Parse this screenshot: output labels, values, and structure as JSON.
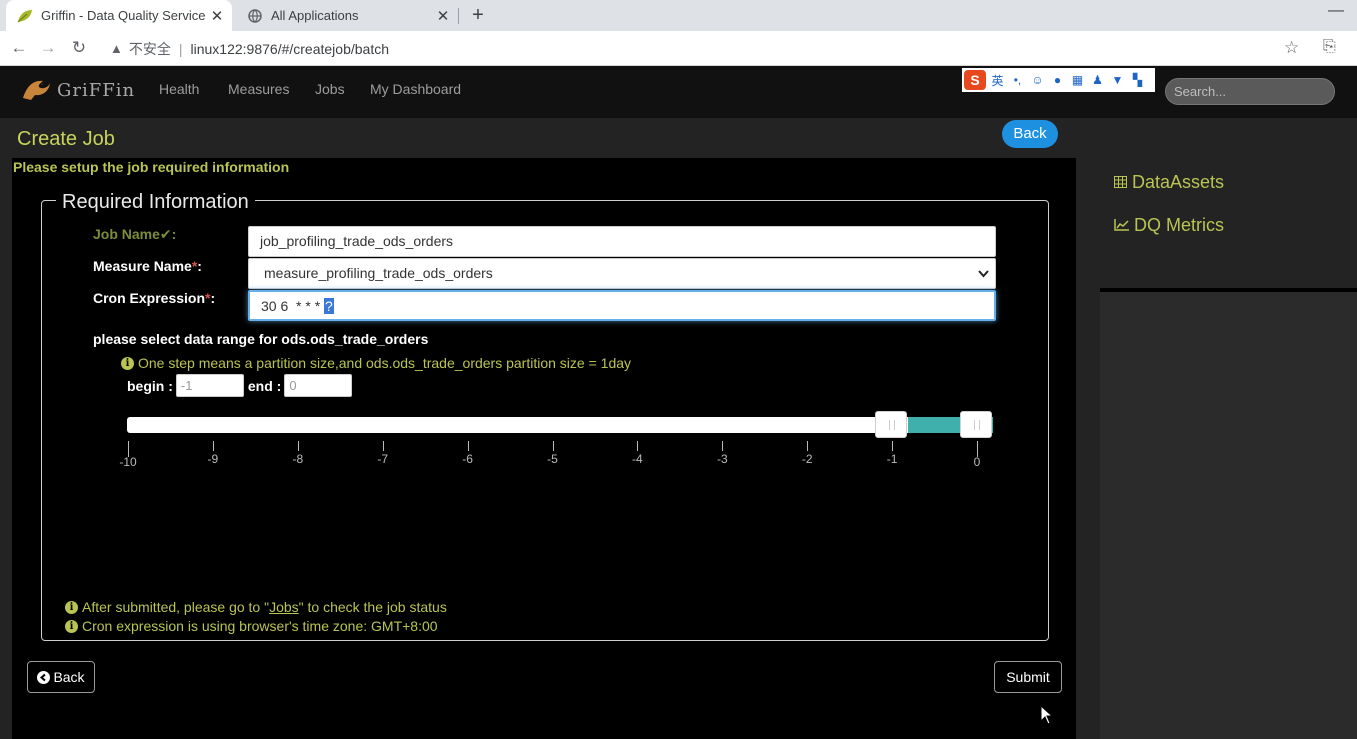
{
  "browser": {
    "tabs": [
      {
        "title": "Griffin - Data Quality Service",
        "active": true
      },
      {
        "title": "All Applications",
        "active": false
      }
    ],
    "address": {
      "insecure_label": "不安全",
      "url": "linux122:9876/#/createjob/batch"
    }
  },
  "navbar": {
    "brand": "GriFFin",
    "items": [
      "Health",
      "Measures",
      "Jobs",
      "My Dashboard"
    ],
    "ime": {
      "lang": "英"
    },
    "search_placeholder": "Search..."
  },
  "page": {
    "title": "Create Job",
    "back_top_label": "Back",
    "subtitle": "Please setup the job required information",
    "section_title": "Required Information"
  },
  "form": {
    "job_name_label": "Job Name",
    "job_name_value": "job_profiling_trade_ods_orders",
    "measure_name_label": "Measure Name",
    "measure_name_value": "measure_profiling_trade_ods_orders",
    "cron_label": "Cron Expression",
    "cron_value": "30 6  * * * ",
    "cron_selected": "?",
    "required_mark": "*",
    "colon": ":"
  },
  "range": {
    "title": "please select data range for ods.ods_trade_orders",
    "info": "One step means a partition size,and ods.ods_trade_orders partition size = 1day",
    "begin_label": "begin :",
    "begin_value": "-1",
    "end_label": "end :",
    "end_value": "0",
    "ticks": [
      "-10",
      "-9",
      "-8",
      "-7",
      "-6",
      "-5",
      "-4",
      "-3",
      "-2",
      "-1",
      "0"
    ],
    "selected_begin": -1,
    "selected_end": 0
  },
  "footer": {
    "info1_prefix": "After submitted, please go to \"",
    "info1_link": "Jobs",
    "info1_suffix": "\" to check the job status",
    "info2": "Cron expression is using browser's time zone: GMT+8:00",
    "back_label": "Back",
    "submit_label": "Submit"
  },
  "sidebar": {
    "items": [
      "DataAssets",
      "DQ Metrics"
    ]
  },
  "colors": {
    "accent": "#b9c452",
    "button_blue": "#1e90e0",
    "slider_fill": "#3fb0ac"
  }
}
